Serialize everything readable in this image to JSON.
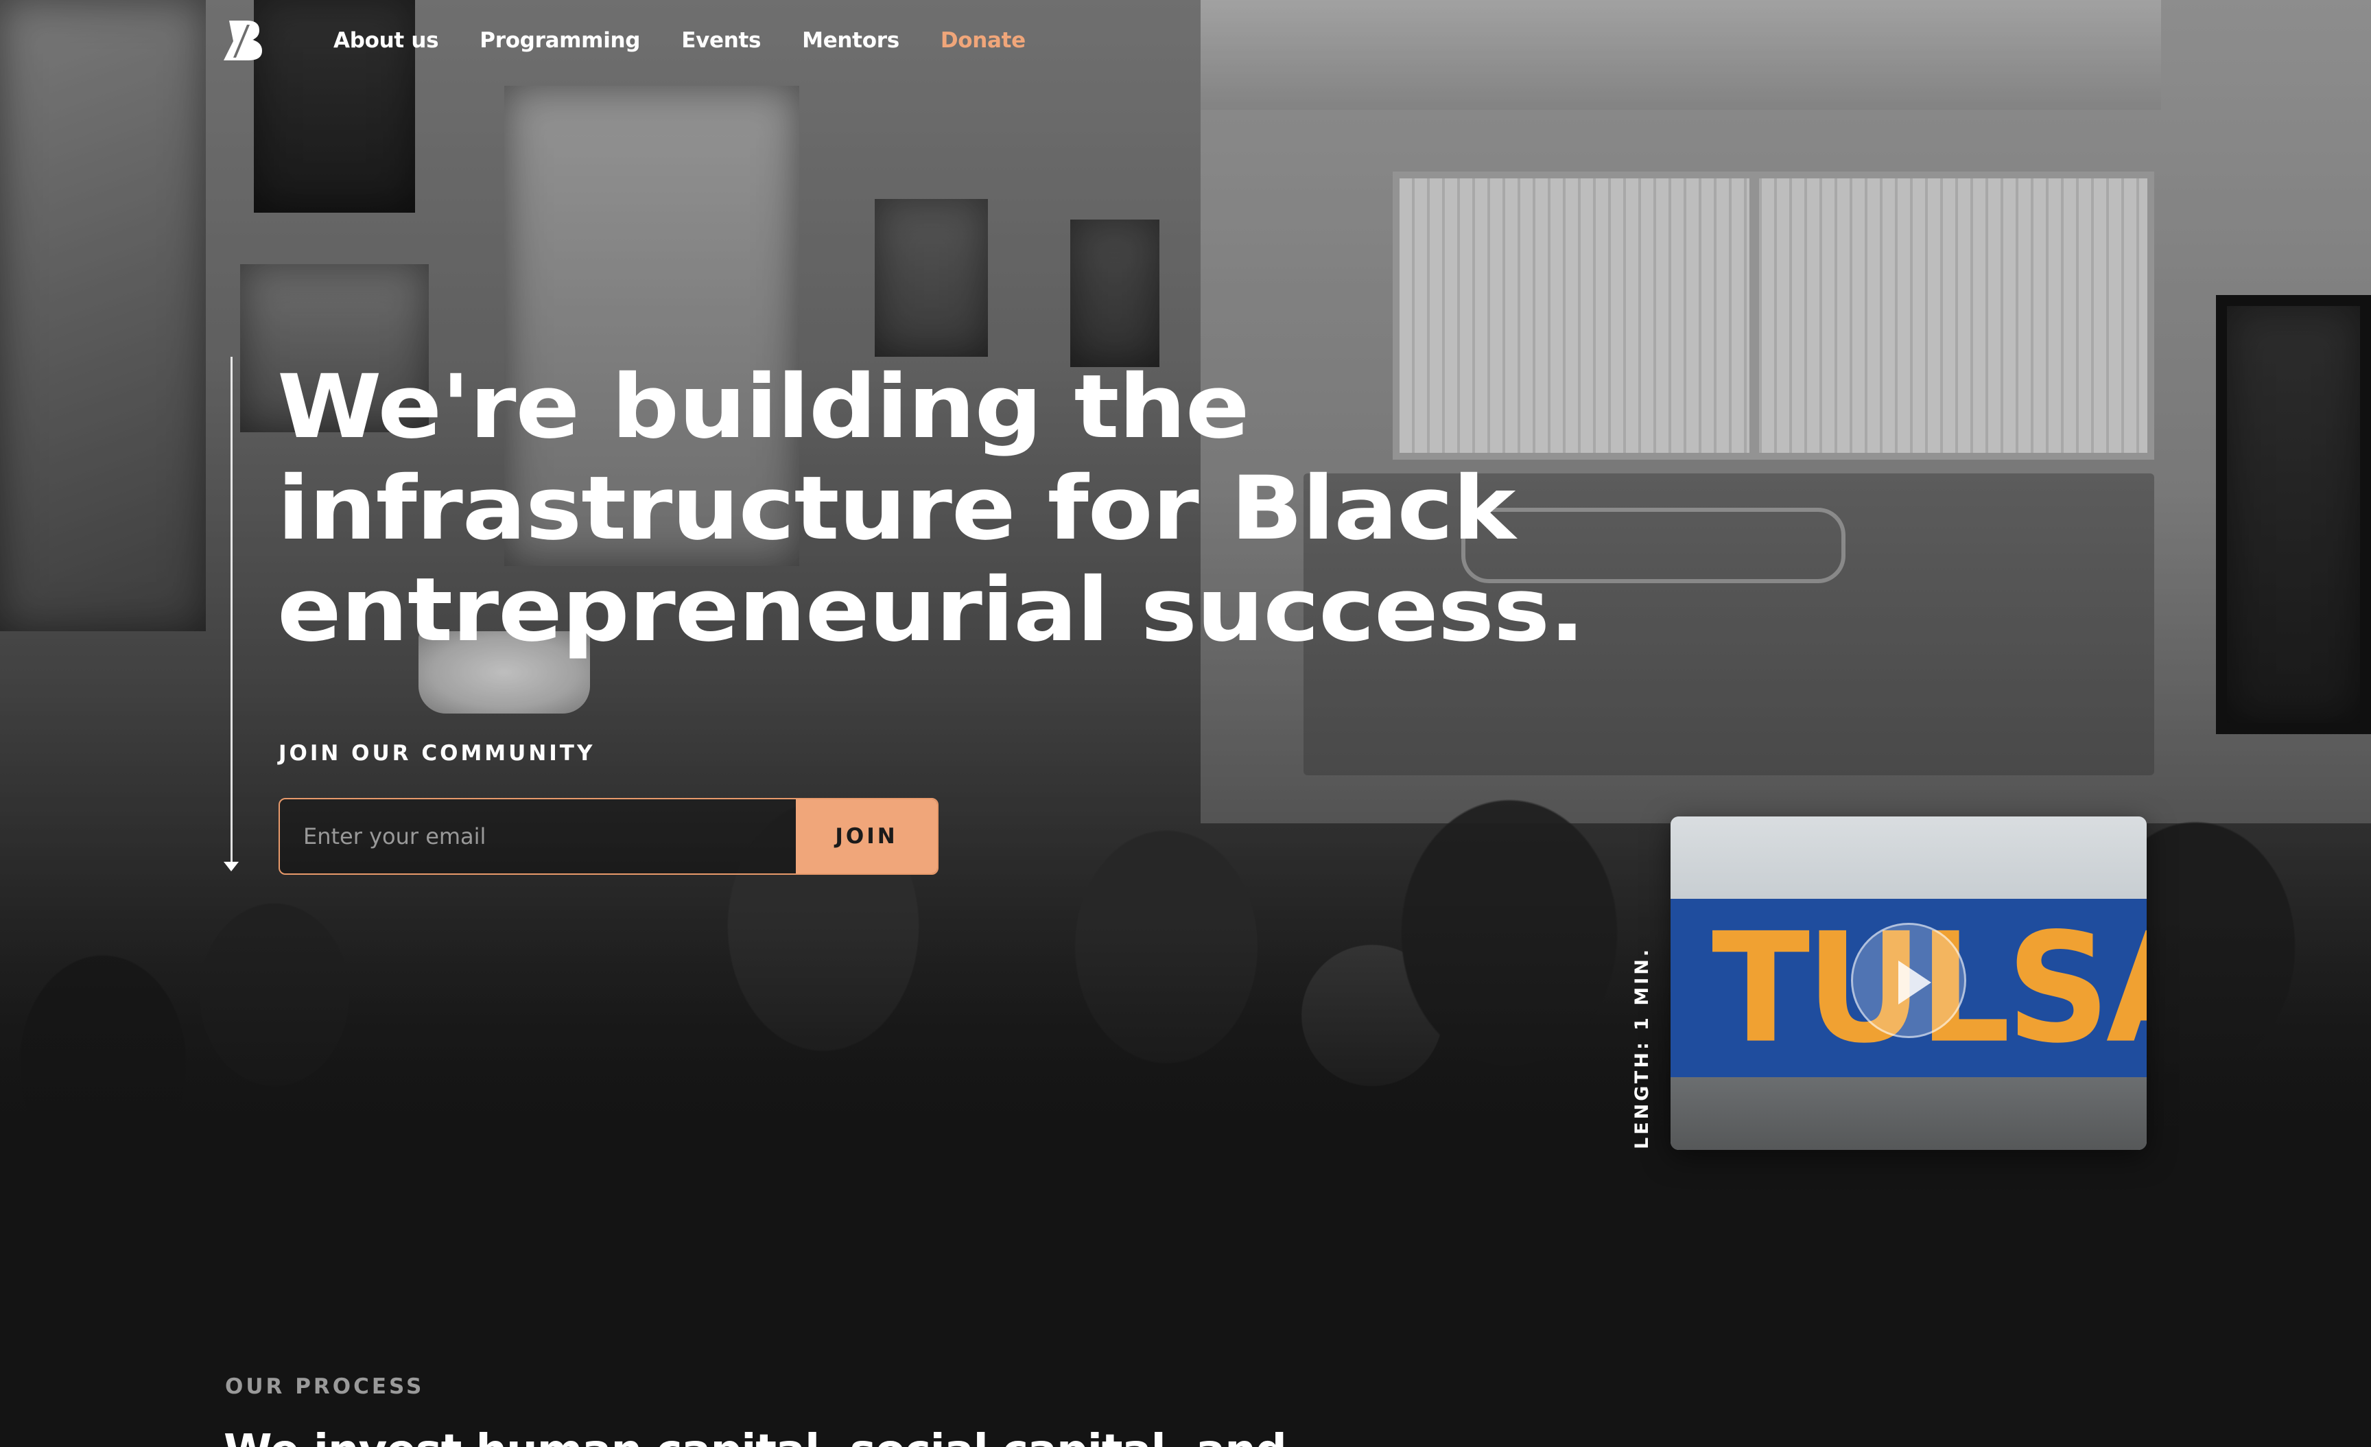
{
  "nav": {
    "items": [
      {
        "label": "About us"
      },
      {
        "label": "Programming"
      },
      {
        "label": "Events"
      },
      {
        "label": "Mentors"
      },
      {
        "label": "Donate"
      }
    ]
  },
  "hero": {
    "headline_lines": [
      "We're building the",
      "infrastructure for Black",
      "entrepreneurial success."
    ],
    "join_label": "JOIN OUR COMMUNITY",
    "email_placeholder": "Enter your email",
    "join_button": "JOIN"
  },
  "video": {
    "length_label": "LENGTH: 1 MIN.",
    "thumbnail_text": [
      "T",
      "U",
      "L",
      "S",
      "A"
    ]
  },
  "process": {
    "label": "OUR PROCESS",
    "title": "We invest human capital, social capital, and"
  },
  "colors": {
    "accent": "#f0a67a",
    "background": "#141414",
    "text": "#ffffff"
  },
  "icons": {
    "logo": "brand-b-logo-icon",
    "play": "play-icon",
    "scroll": "arrow-down-icon"
  }
}
